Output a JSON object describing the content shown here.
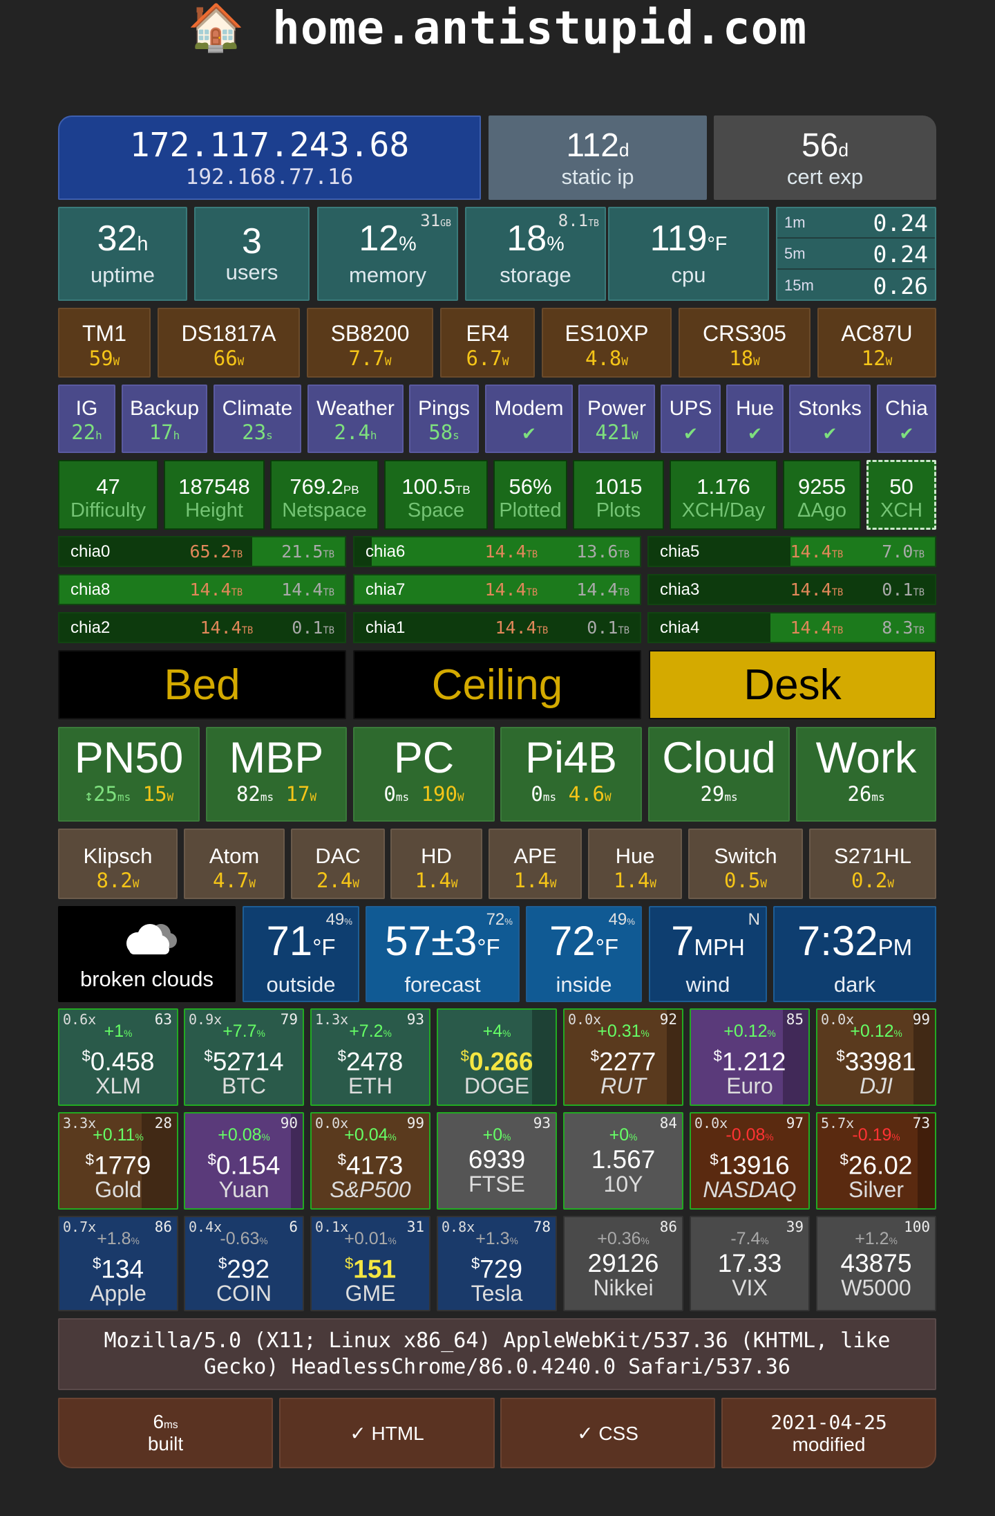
{
  "header": {
    "icon": "🏠",
    "title": "home.antistupid.com"
  },
  "network": {
    "public_ip": "172.117.243.68",
    "local_ip": "192.168.77.16",
    "static_ip_value": "112",
    "static_ip_unit": "d",
    "static_ip_label": "static ip",
    "cert_value": "56",
    "cert_unit": "d",
    "cert_label": "cert exp"
  },
  "system": {
    "uptime_value": "32",
    "uptime_unit": "h",
    "uptime_label": "uptime",
    "users_value": "3",
    "users_label": "users",
    "memory_value": "12",
    "memory_unit": "%",
    "memory_total": "31",
    "memory_total_unit": "GB",
    "memory_label": "memory",
    "storage_value": "18",
    "storage_unit": "%",
    "storage_total": "8.1",
    "storage_total_unit": "TB",
    "storage_label": "storage",
    "cpu_value": "119",
    "cpu_unit": "°F",
    "cpu_label": "cpu",
    "load": [
      {
        "k": "1m",
        "v": "0.24"
      },
      {
        "k": "5m",
        "v": "0.24"
      },
      {
        "k": "15m",
        "v": "0.26"
      }
    ]
  },
  "power": [
    {
      "n": "TM1",
      "v": "59",
      "u": "W"
    },
    {
      "n": "DS1817A",
      "v": "66",
      "u": "W"
    },
    {
      "n": "SB8200",
      "v": "7.7",
      "u": "W"
    },
    {
      "n": "ER4",
      "v": "6.7",
      "u": "W"
    },
    {
      "n": "ES10XP",
      "v": "4.8",
      "u": "W"
    },
    {
      "n": "CRS305",
      "v": "18",
      "u": "W"
    },
    {
      "n": "AC87U",
      "v": "12",
      "u": "W"
    }
  ],
  "health": [
    {
      "n": "IG",
      "v": "22",
      "u": "h"
    },
    {
      "n": "Backup",
      "v": "17",
      "u": "h"
    },
    {
      "n": "Climate",
      "v": "23",
      "u": "s"
    },
    {
      "n": "Weather",
      "v": "2.4",
      "u": "h"
    },
    {
      "n": "Pings",
      "v": "58",
      "u": "s"
    },
    {
      "n": "Modem",
      "v": "✔",
      "u": ""
    },
    {
      "n": "Power",
      "v": "421",
      "u": "W"
    },
    {
      "n": "UPS",
      "v": "✔",
      "u": ""
    },
    {
      "n": "Hue",
      "v": "✔",
      "u": ""
    },
    {
      "n": "Stonks",
      "v": "✔",
      "u": ""
    },
    {
      "n": "Chia",
      "v": "✔",
      "u": ""
    }
  ],
  "chia_stats": [
    {
      "v": "47",
      "u": "",
      "l": "Difficulty"
    },
    {
      "v": "187548",
      "u": "",
      "l": "Height"
    },
    {
      "v": "769.2",
      "u": "PB",
      "l": "Netspace"
    },
    {
      "v": "100.5",
      "u": "TB",
      "l": "Space"
    },
    {
      "v": "56%",
      "u": "",
      "l": "Plotted"
    },
    {
      "v": "1015",
      "u": "",
      "l": "Plots"
    },
    {
      "v": "1.176",
      "u": "",
      "l": "XCH/Day"
    },
    {
      "v": "9255",
      "u": "",
      "l": "ΔAgo"
    },
    {
      "v": "50",
      "u": "",
      "l": "XCH"
    }
  ],
  "chia_drives": [
    {
      "n": "chia0",
      "a": "65.2",
      "au": "TB",
      "b": "21.5",
      "bu": "TB",
      "fill": 0.67
    },
    {
      "n": "chia6",
      "a": "14.4",
      "au": "TB",
      "b": "13.6",
      "bu": "TB",
      "fill": 0.06
    },
    {
      "n": "chia5",
      "a": "14.4",
      "au": "TB",
      "b": "7.0",
      "bu": "TB",
      "fill": 0.49
    },
    {
      "n": "chia8",
      "a": "14.4",
      "au": "TB",
      "b": "14.4",
      "bu": "TB",
      "fill": 0.0
    },
    {
      "n": "chia7",
      "a": "14.4",
      "au": "TB",
      "b": "14.4",
      "bu": "TB",
      "fill": 0.0
    },
    {
      "n": "chia3",
      "a": "14.4",
      "au": "TB",
      "b": "0.1",
      "bu": "TB",
      "fill": 0.99
    },
    {
      "n": "chia2",
      "a": "14.4",
      "au": "TB",
      "b": "0.1",
      "bu": "TB",
      "fill": 0.99
    },
    {
      "n": "chia1",
      "a": "14.4",
      "au": "TB",
      "b": "0.1",
      "bu": "TB",
      "fill": 0.99
    },
    {
      "n": "chia4",
      "a": "14.4",
      "au": "TB",
      "b": "8.3",
      "bu": "TB",
      "fill": 0.42
    }
  ],
  "lights": [
    {
      "n": "Bed",
      "on": false
    },
    {
      "n": "Ceiling",
      "on": false
    },
    {
      "n": "Desk",
      "on": true
    }
  ],
  "devices": [
    {
      "n": "PN50",
      "p": "25",
      "pu": "ms",
      "w": "15",
      "wu": "W",
      "arrow": "↕"
    },
    {
      "n": "MBP",
      "p": "82",
      "pu": "ms",
      "w": "17",
      "wu": "W",
      "arrow": ""
    },
    {
      "n": "PC",
      "p": "0",
      "pu": "ms",
      "w": "190",
      "wu": "W",
      "arrow": ""
    },
    {
      "n": "Pi4B",
      "p": "0",
      "pu": "ms",
      "w": "4.6",
      "wu": "W",
      "arrow": ""
    },
    {
      "n": "Cloud",
      "p": "29",
      "pu": "ms",
      "w": "",
      "wu": "",
      "arrow": ""
    },
    {
      "n": "Work",
      "p": "26",
      "pu": "ms",
      "w": "",
      "wu": "",
      "arrow": ""
    }
  ],
  "speakers": [
    {
      "n": "Klipsch",
      "v": "8.2",
      "u": "W"
    },
    {
      "n": "Atom",
      "v": "4.7",
      "u": "W"
    },
    {
      "n": "DAC",
      "v": "2.4",
      "u": "W"
    },
    {
      "n": "HD",
      "v": "1.4",
      "u": "W"
    },
    {
      "n": "APE",
      "v": "1.4",
      "u": "W"
    },
    {
      "n": "Hue",
      "v": "1.4",
      "u": "W"
    },
    {
      "n": "Switch",
      "v": "0.5",
      "u": "W"
    },
    {
      "n": "S271HL",
      "v": "0.2",
      "u": "W"
    }
  ],
  "weather": {
    "condition": "broken clouds",
    "outside": {
      "v": "71",
      "u": "°F",
      "l": "outside",
      "c": "49",
      "cu": "%"
    },
    "forecast": {
      "v": "57±3",
      "u": "°F",
      "l": "forecast",
      "c": "72",
      "cu": "%"
    },
    "inside": {
      "v": "72",
      "u": "°F",
      "l": "inside",
      "c": "49",
      "cu": "%"
    },
    "wind": {
      "v": "7",
      "u": "MPH",
      "l": "wind",
      "c": "N",
      "cu": ""
    },
    "time": {
      "v": "7:32",
      "u": "PM",
      "l": "dark",
      "c": "",
      "cu": ""
    }
  },
  "stonks": [
    {
      "tl": "0.6x",
      "tr": "63",
      "ch": "+1",
      "cu": "%",
      "cur": "$",
      "pr": "0.458",
      "n": "XLM",
      "it": false,
      "bg": "#2a5a4a",
      "chc": "#66ff66",
      "prc": "#fff",
      "vol": 0
    },
    {
      "tl": "0.9x",
      "tr": "79",
      "ch": "+7.7",
      "cu": "%",
      "cur": "$",
      "pr": "52714",
      "n": "BTC",
      "it": false,
      "bg": "#2a5a4a",
      "chc": "#66ff66",
      "prc": "#fff",
      "vol": 0
    },
    {
      "tl": "1.3x",
      "tr": "93",
      "ch": "+7.2",
      "cu": "%",
      "cur": "$",
      "pr": "2478",
      "n": "ETH",
      "it": false,
      "bg": "#2a5a4a",
      "chc": "#66ff66",
      "prc": "#fff",
      "vol": 0
    },
    {
      "tl": "",
      "tr": "",
      "ch": "+4",
      "cu": "%",
      "cur": "$",
      "pr": "0.266",
      "n": "DOGE",
      "it": false,
      "bg": "#2a5a4a",
      "chc": "#66ff66",
      "prc": "#f5e642",
      "vol": 0.2
    },
    {
      "tl": "0.0x",
      "tr": "92",
      "ch": "+0.31",
      "cu": "%",
      "cur": "$",
      "pr": "2277",
      "n": "RUT",
      "it": true,
      "bg": "#5a3a1e",
      "chc": "#66ff66",
      "prc": "#fff",
      "vol": 0.13
    },
    {
      "tl": "",
      "tr": "85",
      "ch": "+0.12",
      "cu": "%",
      "cur": "$",
      "pr": "1.212",
      "n": "Euro",
      "it": false,
      "bg": "#5a3a7a",
      "chc": "#66ff66",
      "prc": "#fff",
      "vol": 0.22
    },
    {
      "tl": "0.0x",
      "tr": "99",
      "ch": "+0.12",
      "cu": "%",
      "cur": "$",
      "pr": "33981",
      "n": "DJI",
      "it": true,
      "bg": "#5a3a1e",
      "chc": "#66ff66",
      "prc": "#fff",
      "vol": 0.18
    },
    {
      "tl": "3.3x",
      "tr": "28",
      "ch": "+0.11",
      "cu": "%",
      "cur": "$",
      "pr": "1779",
      "n": "Gold",
      "it": false,
      "bg": "#5a3a1e",
      "chc": "#66ff66",
      "prc": "#fff",
      "vol": 0.3
    },
    {
      "tl": "",
      "tr": "90",
      "ch": "+0.08",
      "cu": "%",
      "cur": "$",
      "pr": "0.154",
      "n": "Yuan",
      "it": false,
      "bg": "#5a3a7a",
      "chc": "#66ff66",
      "prc": "#fff",
      "vol": 0.1
    },
    {
      "tl": "0.0x",
      "tr": "99",
      "ch": "+0.04",
      "cu": "%",
      "cur": "$",
      "pr": "4173",
      "n": "S&P500",
      "it": true,
      "bg": "#5a3a1e",
      "chc": "#66ff66",
      "prc": "#fff",
      "vol": 0
    },
    {
      "tl": "",
      "tr": "93",
      "ch": "+0",
      "cu": "%",
      "cur": "",
      "pr": "6939",
      "n": "FTSE",
      "it": false,
      "bg": "#555555",
      "chc": "#66ff66",
      "prc": "#fff",
      "vol": 0
    },
    {
      "tl": "",
      "tr": "84",
      "ch": "+0",
      "cu": "%",
      "cur": "",
      "pr": "1.567",
      "n": "10Y",
      "it": false,
      "bg": "#555555",
      "chc": "#66ff66",
      "prc": "#fff",
      "vol": 0
    },
    {
      "tl": "0.0x",
      "tr": "97",
      "ch": "-0.08",
      "cu": "%",
      "cur": "$",
      "pr": "13916",
      "n": "NASDAQ",
      "it": true,
      "bg": "#5a2a10",
      "chc": "#ff3333",
      "prc": "#fff",
      "vol": 0
    },
    {
      "tl": "5.7x",
      "tr": "73",
      "ch": "-0.19",
      "cu": "%",
      "cur": "$",
      "pr": "26.02",
      "n": "Silver",
      "it": false,
      "bg": "#5a2a10",
      "chc": "#ff3333",
      "prc": "#fff",
      "vol": 0.15
    },
    {
      "tl": "0.7x",
      "tr": "86",
      "ch": "+1.8",
      "cu": "%",
      "cur": "$",
      "pr": "134",
      "n": "Apple",
      "it": false,
      "bg": "#1a3a6a",
      "chc": "#aaaaaa",
      "prc": "#fff",
      "vol": 0
    },
    {
      "tl": "0.4x",
      "tr": "6",
      "ch": "-0.63",
      "cu": "%",
      "cur": "$",
      "pr": "292",
      "n": "COIN",
      "it": false,
      "bg": "#1a3a6a",
      "chc": "#aaaaaa",
      "prc": "#fff",
      "vol": 0
    },
    {
      "tl": "0.1x",
      "tr": "31",
      "ch": "+0.01",
      "cu": "%",
      "cur": "$",
      "pr": "151",
      "n": "GME",
      "it": false,
      "bg": "#1a3a6a",
      "chc": "#aaaaaa",
      "prc": "#f5e642",
      "vol": 0
    },
    {
      "tl": "0.8x",
      "tr": "78",
      "ch": "+1.3",
      "cu": "%",
      "cur": "$",
      "pr": "729",
      "n": "Tesla",
      "it": false,
      "bg": "#1a3a6a",
      "chc": "#aaaaaa",
      "prc": "#fff",
      "vol": 0
    },
    {
      "tl": "",
      "tr": "86",
      "ch": "+0.36",
      "cu": "%",
      "cur": "",
      "pr": "29126",
      "n": "Nikkei",
      "it": false,
      "bg": "#4a4a4a",
      "chc": "#aaaaaa",
      "prc": "#fff",
      "vol": 0
    },
    {
      "tl": "",
      "tr": "39",
      "ch": "-7.4",
      "cu": "%",
      "cur": "",
      "pr": "17.33",
      "n": "VIX",
      "it": false,
      "bg": "#4a4a4a",
      "chc": "#aaaaaa",
      "prc": "#fff",
      "vol": 0
    },
    {
      "tl": "",
      "tr": "100",
      "ch": "+1.2",
      "cu": "%",
      "cur": "",
      "pr": "43875",
      "n": "W5000",
      "it": false,
      "bg": "#4a4a4a",
      "chc": "#aaaaaa",
      "prc": "#fff",
      "vol": 0
    }
  ],
  "user_agent": "Mozilla/5.0 (X11; Linux x86_64) AppleWebKit/537.36 (KHTML, like Gecko) HeadlessChrome/86.0.4240.0 Safari/537.36",
  "footer": {
    "built_value": "6",
    "built_unit": "ms",
    "built_label": "built",
    "html": "✓ HTML",
    "css": "✓ CSS",
    "modified_date": "2021-04-25",
    "modified_label": "modified"
  },
  "colors": {
    "public_ip": "#1c3f8f",
    "static": "#566878",
    "cert": "#4a4a4a",
    "sys": "#2a6060",
    "power": "#5a3a1a",
    "health": "#4a4a8a",
    "chia": "#1a6a1a",
    "light_on": "#d4aa00",
    "light_off": "#000000",
    "device": "#2e6a2e",
    "speaker": "#5a4a3a",
    "weather": "#0e3e70",
    "footer": "#5a3322",
    "ua": "#4a3a3a"
  }
}
